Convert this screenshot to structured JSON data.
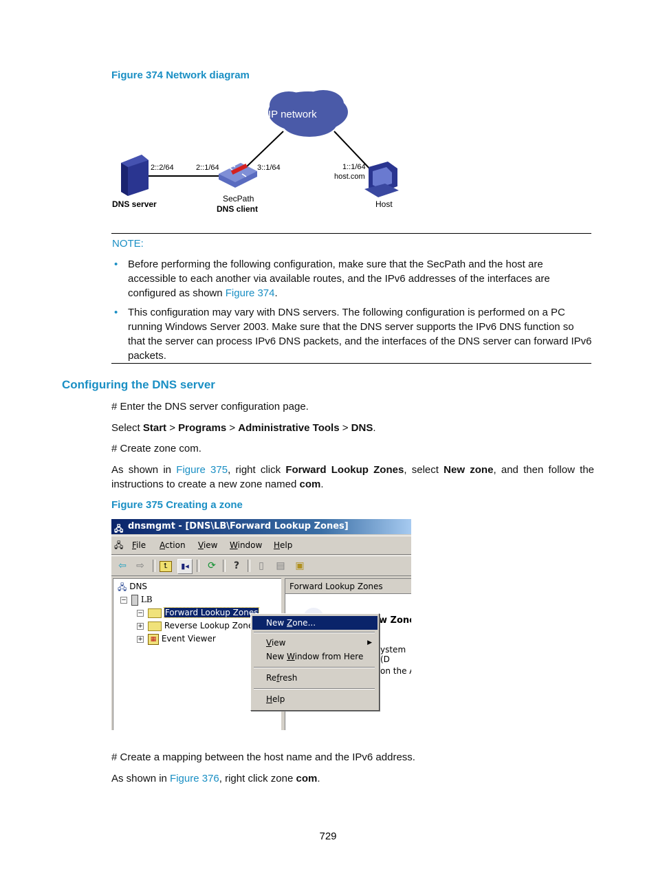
{
  "figure374": {
    "caption": "Figure 374 Network diagram",
    "cloud_label": "IP network",
    "dns_server_label": "DNS server",
    "dns_server_ip": "2::2/64",
    "secpath_left_ip": "2::1/64",
    "secpath_right_ip": "3::1/64",
    "secpath_label": "SecPath",
    "secpath_role": "DNS client",
    "host_ip": "1::1/64",
    "host_name": "host.com",
    "host_label": "Host"
  },
  "note": {
    "title": "NOTE:",
    "items": [
      {
        "text_before": "Before performing the following configuration, make sure that the SecPath and the host are accessible to each another via available routes, and the IPv6 addresses of the interfaces are configured as shown ",
        "link": "Figure 374",
        "text_after": "."
      },
      {
        "text": "This configuration may vary with DNS servers. The following configuration is performed on a PC running Windows Server 2003. Make sure that the DNS server supports the IPv6 DNS function so that the server can process IPv6 DNS packets, and the interfaces of the DNS server can forward IPv6 packets."
      }
    ]
  },
  "section": {
    "heading": "Configuring the DNS server",
    "step1": "# Enter the DNS server configuration page.",
    "select_prefix": "Select ",
    "select_start": "Start",
    "select_sep": " > ",
    "select_programs": "Programs",
    "select_admin": "Administrative Tools",
    "select_dns": "DNS",
    "select_end": ".",
    "step2": "# Create zone com.",
    "para_as_shown": "As shown in ",
    "para_link": "Figure 375",
    "para_right_click": ", right click ",
    "para_flz": "Forward Lookup Zones",
    "para_select": ", select ",
    "para_newzone": "New zone",
    "para_follow": ", and then follow the instructions to create a new zone named ",
    "para_com": "com",
    "para_end": "."
  },
  "figure375": {
    "caption": "Figure 375 Creating a zone",
    "window_title": "dnsmgmt - [DNS\\LB\\Forward Lookup Zones]",
    "menu": [
      "File",
      "Action",
      "View",
      "Window",
      "Help"
    ],
    "tree": {
      "root": "DNS",
      "server": "LB",
      "items": [
        "Forward Lookup Zones",
        "Reverse Lookup Zones",
        "Event Viewer"
      ]
    },
    "right_pane_header": "Forward Lookup Zones",
    "right_pane_fragments": [
      "w Zone",
      "ystem (D",
      "on the A"
    ],
    "context_menu": [
      "New Zone...",
      "View",
      "New Window from Here",
      "Refresh",
      "Help"
    ]
  },
  "after": {
    "step3": "# Create a mapping between the host name and the IPv6 address.",
    "as_shown": "As shown in ",
    "link": "Figure 376",
    "right_click": ", right click zone ",
    "com": "com",
    "end": "."
  },
  "page_number": "729"
}
